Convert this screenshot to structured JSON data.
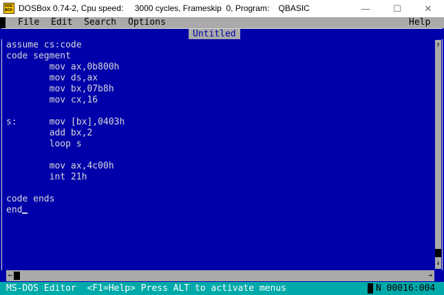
{
  "window": {
    "icon_text": "DOS BOX",
    "title": "DOSBox 0.74-2, Cpu speed:     3000 cycles, Frameskip  0, Program:    QBASIC",
    "minimize_glyph": "—",
    "maximize_glyph": "☐",
    "close_glyph": "✕"
  },
  "menu": {
    "items": [
      "File",
      "Edit",
      "Search",
      "Options"
    ],
    "help": "Help"
  },
  "document": {
    "title": "Untitled",
    "lines": [
      "assume cs:code",
      "code segment",
      "        mov ax,0b800h",
      "        mov ds,ax",
      "        mov bx,07b8h",
      "        mov cx,16",
      "",
      "s:      mov [bx],0403h",
      "        add bx,2",
      "        loop s",
      "",
      "        mov ax,4c00h",
      "        int 21h",
      "",
      "code ends",
      "end"
    ]
  },
  "scrollbar": {
    "up_arrow": "↑",
    "down_arrow": "↓",
    "left_arrow": "←",
    "right_arrow": "→"
  },
  "status": {
    "left": "MS-DOS Editor  <F1=Help> Press ALT to activate menus",
    "right": "N 00016:004"
  },
  "colors": {
    "screen_bg": "#0000aa",
    "text": "#d8d8d8",
    "menu_bg": "#aaaaaa",
    "status_bg": "#00aaaa"
  }
}
